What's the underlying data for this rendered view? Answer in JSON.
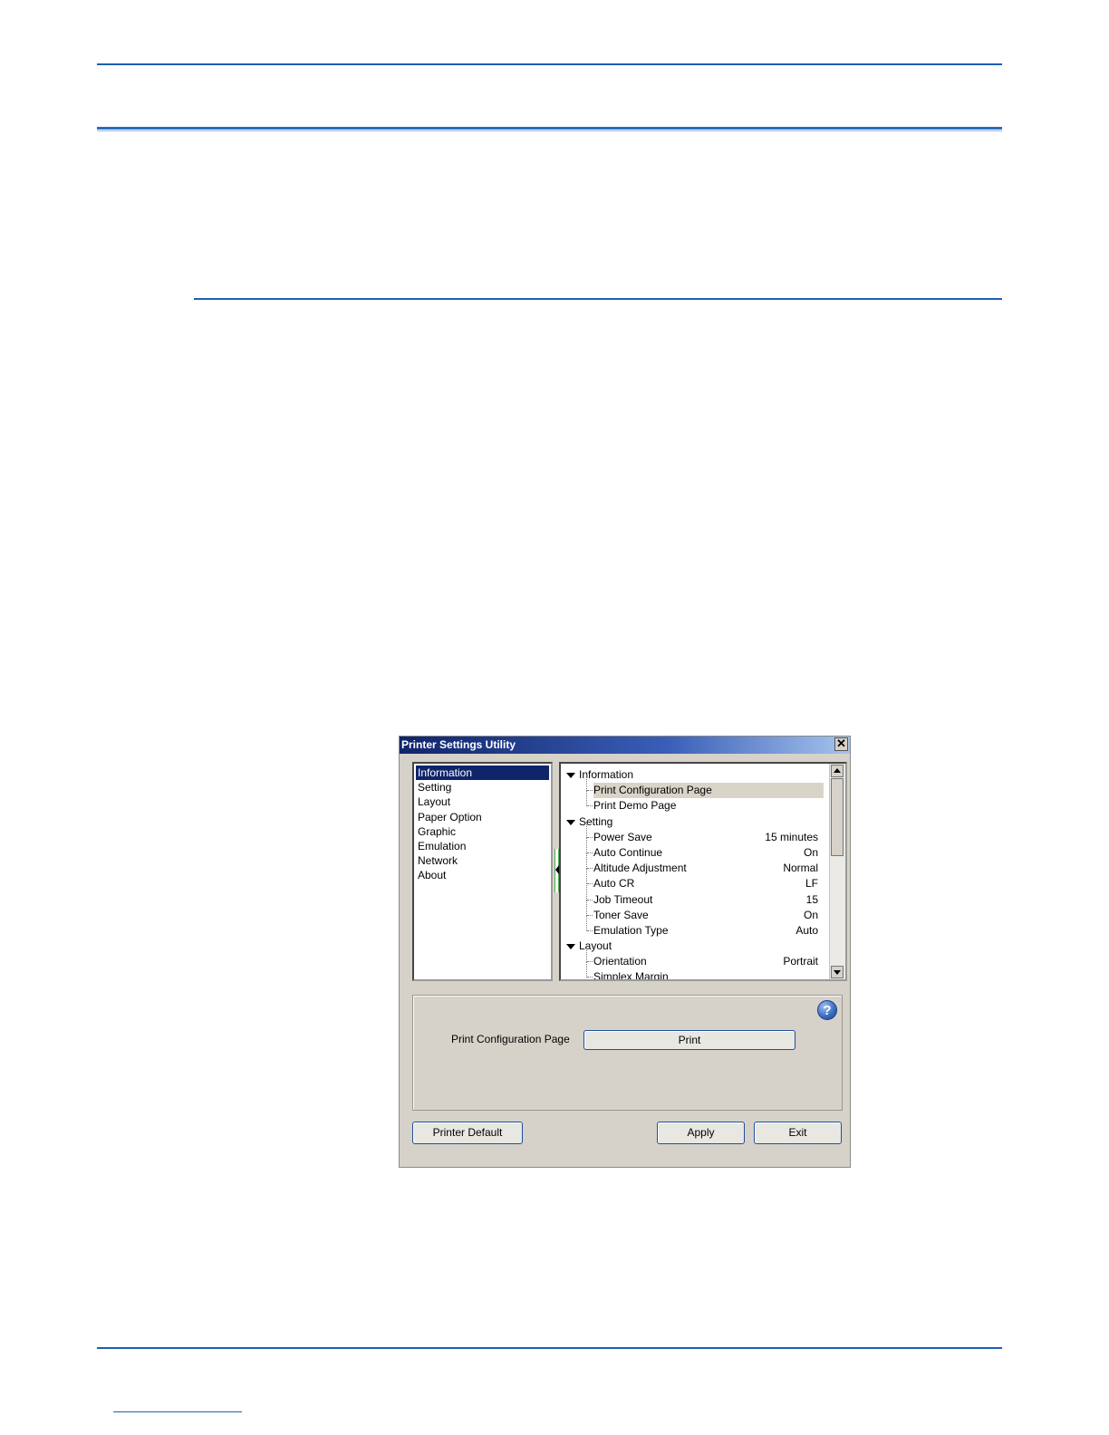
{
  "dialog": {
    "title": "Printer Settings Utility",
    "close_glyph": "✕",
    "categories": [
      "Information",
      "Setting",
      "Layout",
      "Paper Option",
      "Graphic",
      "Emulation",
      "Network",
      "About"
    ],
    "selected_category": "Information",
    "tree": {
      "information": {
        "label": "Information",
        "items": [
          {
            "label": "Print Configuration Page"
          },
          {
            "label": "Print Demo Page"
          }
        ]
      },
      "setting": {
        "label": "Setting",
        "items": [
          {
            "label": "Power Save",
            "value": "15 minutes"
          },
          {
            "label": "Auto Continue",
            "value": "On"
          },
          {
            "label": "Altitude Adjustment",
            "value": "Normal"
          },
          {
            "label": "Auto CR",
            "value": "LF"
          },
          {
            "label": "Job Timeout",
            "value": "15"
          },
          {
            "label": "Toner Save",
            "value": "On"
          },
          {
            "label": "Emulation Type",
            "value": "Auto"
          }
        ]
      },
      "layout": {
        "label": "Layout",
        "items": [
          {
            "label": "Orientation",
            "value": "Portrait"
          },
          {
            "label": "Simplex Margin",
            "value": ""
          }
        ]
      }
    },
    "panel": {
      "label": "Print Configuration Page",
      "print_button": "Print",
      "help_glyph": "?"
    },
    "buttons": {
      "printer_default": "Printer Default",
      "apply": "Apply",
      "exit": "Exit"
    }
  }
}
